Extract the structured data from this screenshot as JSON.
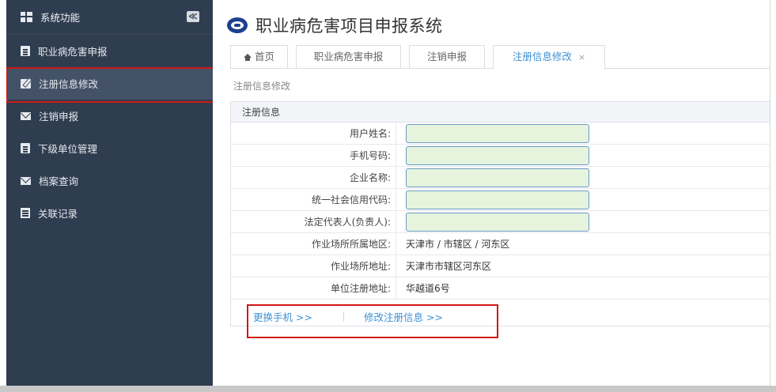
{
  "app": {
    "title": "职业病危害项目申报系统"
  },
  "sidebar": {
    "header_label": "系统功能",
    "collapse_symbol": "≪",
    "items": [
      {
        "label": "职业病危害申报",
        "icon": "document-icon"
      },
      {
        "label": "注册信息修改",
        "icon": "edit-icon",
        "active": true
      },
      {
        "label": "注销申报",
        "icon": "envelope-icon"
      },
      {
        "label": "下级单位管理",
        "icon": "document-icon"
      },
      {
        "label": "档案查询",
        "icon": "envelope-icon"
      },
      {
        "label": "关联记录",
        "icon": "list-icon"
      }
    ]
  },
  "tabs": [
    {
      "label": "首页",
      "icon": "home-icon"
    },
    {
      "label": "职业病危害申报"
    },
    {
      "label": "注销申报"
    },
    {
      "label": "注册信息修改",
      "active": true,
      "close": "×"
    }
  ],
  "breadcrumb": "注册信息修改",
  "panel": {
    "title": "注册信息",
    "fields": [
      {
        "label": "用户姓名:",
        "value": ""
      },
      {
        "label": "手机号码:",
        "value": ""
      },
      {
        "label": "企业名称:",
        "value": ""
      },
      {
        "label": "统一社会信用代码:",
        "value": ""
      },
      {
        "label": "法定代表人(负责人):",
        "value": ""
      },
      {
        "label": "作业场所所属地区:",
        "value": "天津市 / 市辖区 / 河东区"
      },
      {
        "label": "作业场所地址:",
        "value": "天津市市辖区河东区"
      },
      {
        "label": "单位注册地址:",
        "value": "华越道6号"
      }
    ],
    "actions": {
      "change_phone": "更换手机 >>",
      "edit_info": "修改注册信息 >>"
    }
  },
  "colors": {
    "sidebar_bg": "#2f3d50",
    "accent": "#3c91d6",
    "highlight": "#d01818",
    "input_bg": "#e6f4dd"
  }
}
